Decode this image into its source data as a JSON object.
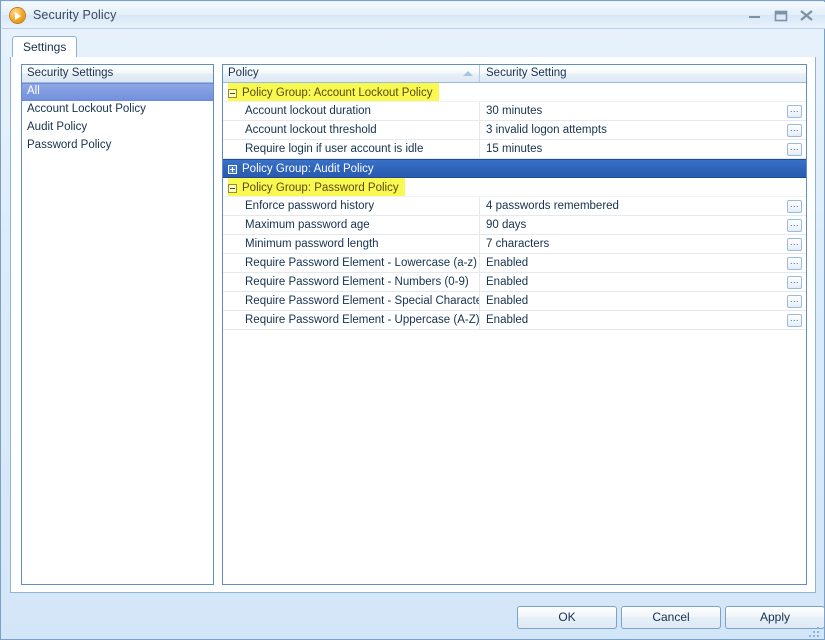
{
  "window": {
    "title": "Security Policy",
    "icon": "app-orb-icon",
    "controls": {
      "minimize": "minimize-icon",
      "maximize": "maximize-icon",
      "close": "close-icon"
    }
  },
  "tabs": [
    {
      "label": "Settings",
      "active": true
    }
  ],
  "left_panel": {
    "header": "Security Settings",
    "items": [
      {
        "label": "All",
        "selected": true
      },
      {
        "label": "Account Lockout Policy",
        "selected": false
      },
      {
        "label": "Audit Policy",
        "selected": false
      },
      {
        "label": "Password Policy",
        "selected": false
      }
    ]
  },
  "grid": {
    "columns": [
      {
        "label": "Policy",
        "sorted": "ascending",
        "sort_icon": "sort-ascending-icon"
      },
      {
        "label": "Security Setting",
        "sorted": ""
      }
    ],
    "rows": [
      {
        "type": "group",
        "label": "Policy Group: Account Lockout Policy",
        "expander": "minus",
        "selected": false,
        "highlight": "#f9f952"
      },
      {
        "type": "data",
        "policy": "Account lockout duration",
        "setting": "30 minutes",
        "button": "..."
      },
      {
        "type": "data",
        "policy": "Account lockout threshold",
        "setting": "3 invalid logon attempts",
        "button": "..."
      },
      {
        "type": "data",
        "policy": "Require login if user account is idle",
        "setting": "15 minutes",
        "button": "..."
      },
      {
        "type": "group",
        "label": "Policy Group: Audit Policy",
        "expander": "plus",
        "selected": true,
        "highlight": "#2e64ba"
      },
      {
        "type": "group",
        "label": "Policy Group: Password Policy",
        "expander": "minus",
        "selected": false,
        "highlight": "#f9f952"
      },
      {
        "type": "data",
        "policy": "Enforce password history",
        "setting": "4 passwords remembered",
        "button": "..."
      },
      {
        "type": "data",
        "policy": "Maximum password age",
        "setting": "90 days",
        "button": "..."
      },
      {
        "type": "data",
        "policy": "Minimum password length",
        "setting": "7 characters",
        "button": "..."
      },
      {
        "type": "data",
        "policy": "Require Password Element - Lowercase (a-z)",
        "setting": "Enabled",
        "button": "..."
      },
      {
        "type": "data",
        "policy": "Require Password Element - Numbers (0-9)",
        "setting": "Enabled",
        "button": "..."
      },
      {
        "type": "data",
        "policy": "Require Password Element - Special Characters",
        "setting": "Enabled",
        "button": "..."
      },
      {
        "type": "data",
        "policy": "Require Password Element - Uppercase (A-Z)",
        "setting": "Enabled",
        "button": "..."
      }
    ]
  },
  "footer": {
    "ok": "OK",
    "cancel": "Cancel",
    "apply": "Apply"
  }
}
